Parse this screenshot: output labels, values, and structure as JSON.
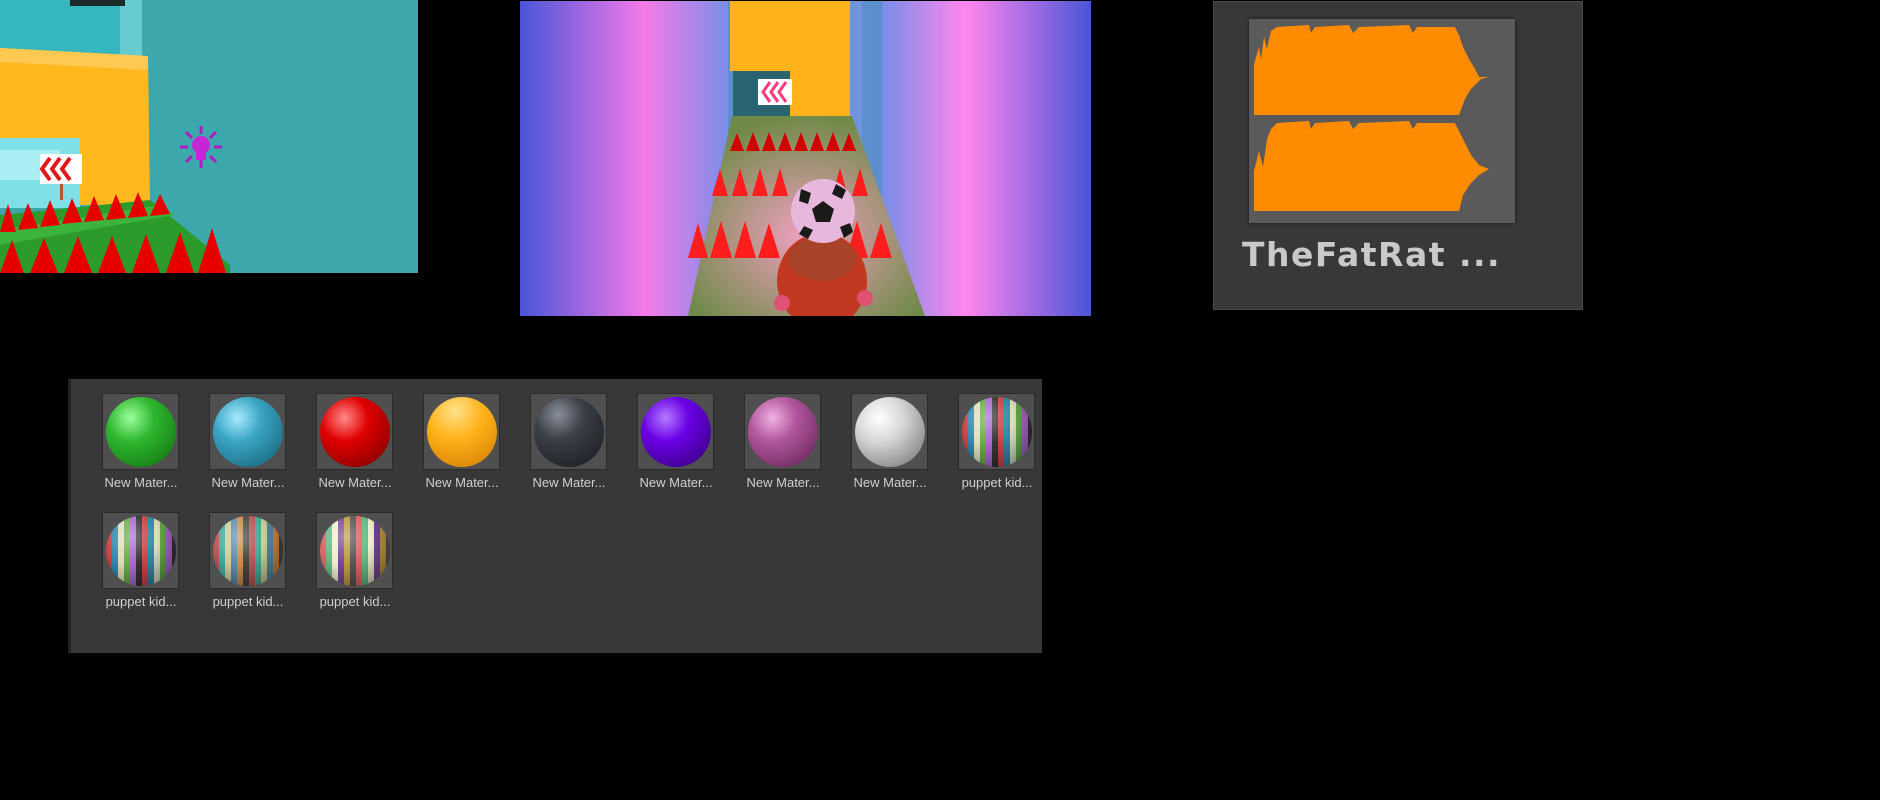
{
  "scene_view": {
    "icons": [
      "light-gizmo-icon",
      "chevron-arrow-sign",
      "red-spike"
    ]
  },
  "game_view": {
    "icons": [
      "soccer-ball",
      "player-character",
      "chevron-arrow-sign",
      "red-spike"
    ]
  },
  "audio_asset": {
    "name": "TheFatRat ...",
    "icon": "audio-waveform-icon",
    "waveform_color": "#ff8c00"
  },
  "materials": {
    "row1": [
      {
        "label": "New Mater...",
        "color": "#2fb82f"
      },
      {
        "label": "New Mater...",
        "color": "#3aa6c4"
      },
      {
        "label": "New Mater...",
        "color": "#e00000"
      },
      {
        "label": "New Mater...",
        "color": "#ffb21a"
      },
      {
        "label": "New Mater...",
        "color": "#3c4048"
      },
      {
        "label": "New Mater...",
        "color": "#6a00e6"
      },
      {
        "label": "New Mater...",
        "color": "#b2569e"
      },
      {
        "label": "New Mater...",
        "color": "#d8d8d8"
      },
      {
        "label": "puppet kid...",
        "color": "striped"
      }
    ],
    "row2": [
      {
        "label": "puppet kid...",
        "color": "striped"
      },
      {
        "label": "puppet kid...",
        "color": "striped"
      },
      {
        "label": "puppet kid...",
        "color": "striped"
      }
    ]
  }
}
